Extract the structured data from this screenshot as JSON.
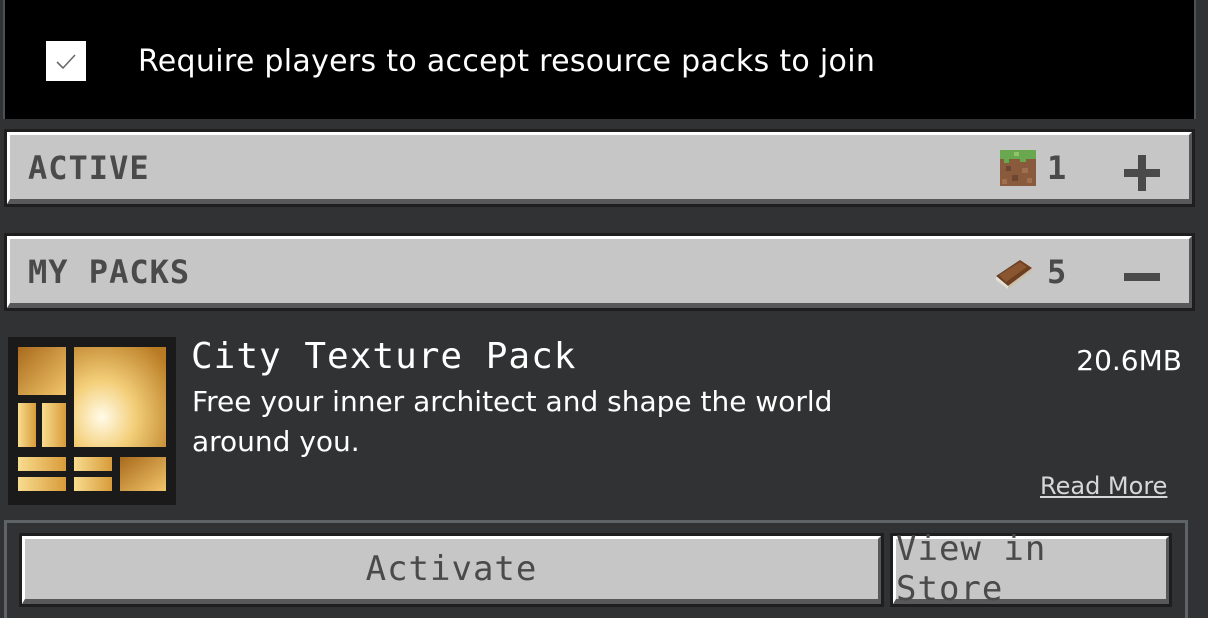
{
  "require": {
    "checked": true,
    "label": "Require players to accept resource packs to join"
  },
  "active_section": {
    "title": "ACTIVE",
    "count": "1",
    "icon": "grass-block-icon",
    "toggle_icon": "plus-icon"
  },
  "my_packs_section": {
    "title": "MY PACKS",
    "count": "5",
    "icon": "book-icon",
    "toggle_icon": "minus-icon"
  },
  "pack": {
    "title": "City Texture Pack",
    "size": "20.6MB",
    "description": "Free your inner architect and shape the world around you.",
    "read_more": "Read More"
  },
  "actions": {
    "activate": "Activate",
    "view_in_store": "View in Store"
  },
  "colors": {
    "panel_bg": "#313233",
    "button_face": "#c6c6c6",
    "button_text": "#4a4a4b"
  }
}
